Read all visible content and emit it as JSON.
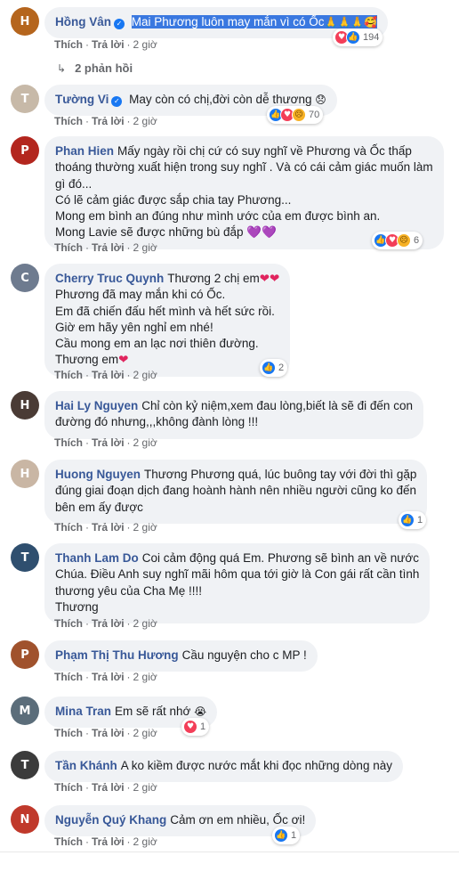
{
  "labels": {
    "like": "Thích",
    "reply": "Trả lời",
    "sep": "·"
  },
  "comments": [
    {
      "author": "Hồng Vân",
      "verified": true,
      "lines": [
        "Mai Phương luôn may mắn vì có Ốc"
      ],
      "emoji": "🙏🙏🙏🥰",
      "time": "2 giờ",
      "reactions": {
        "icons": [
          "love",
          "like"
        ],
        "count": "194"
      },
      "replies": "2 phản hồi",
      "avatar_color": "#b5651d",
      "avatar_initial": "H"
    },
    {
      "author": "Tường Vi",
      "verified": true,
      "lines": [
        "May còn có chị,đời còn dễ thương"
      ],
      "emoji": "😞",
      "time": "2 giờ",
      "reactions": {
        "icons": [
          "like",
          "love",
          "sad"
        ],
        "count": "70"
      },
      "avatar_color": "#c7b9a8",
      "avatar_initial": "T"
    },
    {
      "author": "Phan Hien",
      "verified": false,
      "lines": [
        "Mấy ngày rồi chị cứ có suy nghĩ về Phương và Ốc thấp",
        "thoáng thường xuất hiện trong suy nghĩ . Và có cái cảm giác muốn làm",
        "gì đó...",
        "Có lẽ cảm giác được sắp chia tay Phương...",
        "Mong em bình an đúng như mình ước của em được bình an.",
        "Mong Lavie sẽ được những bù đắp"
      ],
      "emoji": "💜💜",
      "time": "2 giờ",
      "reactions": {
        "icons": [
          "like",
          "love",
          "sad"
        ],
        "count": "6"
      },
      "avatar_color": "#b3261e",
      "avatar_initial": "P"
    },
    {
      "author": "Cherry Truc Quynh",
      "verified": false,
      "lines": [
        "Thương 2 chị em",
        "Phương đã may mắn khi có Ốc.",
        "Em đã chiến đấu hết mình và hết sức rồi.",
        "Giờ em hãy yên nghỉ em nhé!",
        "Cầu mong em an lạc nơi thiên đường.",
        "Thương em"
      ],
      "emoji": "❤❤",
      "emoji_last": "❤",
      "time": "2 giờ",
      "reactions": {
        "icons": [
          "like"
        ],
        "count": "2"
      },
      "avatar_color": "#6e7b8f",
      "avatar_initial": "C"
    },
    {
      "author": "Hai Ly Nguyen",
      "verified": false,
      "lines": [
        "Chỉ còn kỷ niệm,xem đau lòng,biết là sẽ đi đến con",
        "đường đó nhưng,,,không đành lòng !!!"
      ],
      "time": "2 giờ",
      "avatar_color": "#4a3b35",
      "avatar_initial": "H"
    },
    {
      "author": "Huong Nguyen",
      "verified": false,
      "lines": [
        "Thương Phương quá, lúc buông tay với đời thì gặp",
        "đúng giai đoạn dịch đang hoành hành nên nhiều người cũng ko đến",
        "bên em ấy được"
      ],
      "time": "2 giờ",
      "reactions": {
        "icons": [
          "like"
        ],
        "count": "1"
      },
      "avatar_color": "#c9b6a4",
      "avatar_initial": "H"
    },
    {
      "author": "Thanh Lam Do",
      "verified": false,
      "lines": [
        "Coi cảm động quá Em. Phương sẽ bình an về nước",
        "Chúa. Điều Anh suy nghĩ mãi hôm qua tới giờ là Con gái rất cần tình",
        "thương yêu của Cha Mẹ !!!!",
        "Thương"
      ],
      "time": "2 giờ",
      "avatar_color": "#2f4f6f",
      "avatar_initial": "T"
    },
    {
      "author": "Phạm Thị Thu Hương",
      "verified": false,
      "lines": [
        "Cầu nguyện cho c MP !"
      ],
      "time": "2 giờ",
      "avatar_color": "#a0522d",
      "avatar_initial": "P"
    },
    {
      "author": "Mina Tran",
      "verified": false,
      "lines": [
        "Em sẽ rất nhớ"
      ],
      "emoji": "😭",
      "time": "2 giờ",
      "reactions": {
        "icons": [
          "love"
        ],
        "count": "1"
      },
      "avatar_color": "#5b6d7a",
      "avatar_initial": "M"
    },
    {
      "author": "Tần Khánh",
      "verified": false,
      "lines": [
        "A ko kiềm được nước mắt khi đọc những dòng này"
      ],
      "time": "2 giờ",
      "avatar_color": "#3b3b3b",
      "avatar_initial": "T"
    },
    {
      "author": "Nguyễn Quý Khang",
      "verified": false,
      "lines": [
        "Cảm ơn em nhiều, Ốc ơi!"
      ],
      "time": "2 giờ",
      "reactions": {
        "icons": [
          "like"
        ],
        "count": "1"
      },
      "avatar_color": "#c0392b",
      "avatar_initial": "N"
    }
  ]
}
